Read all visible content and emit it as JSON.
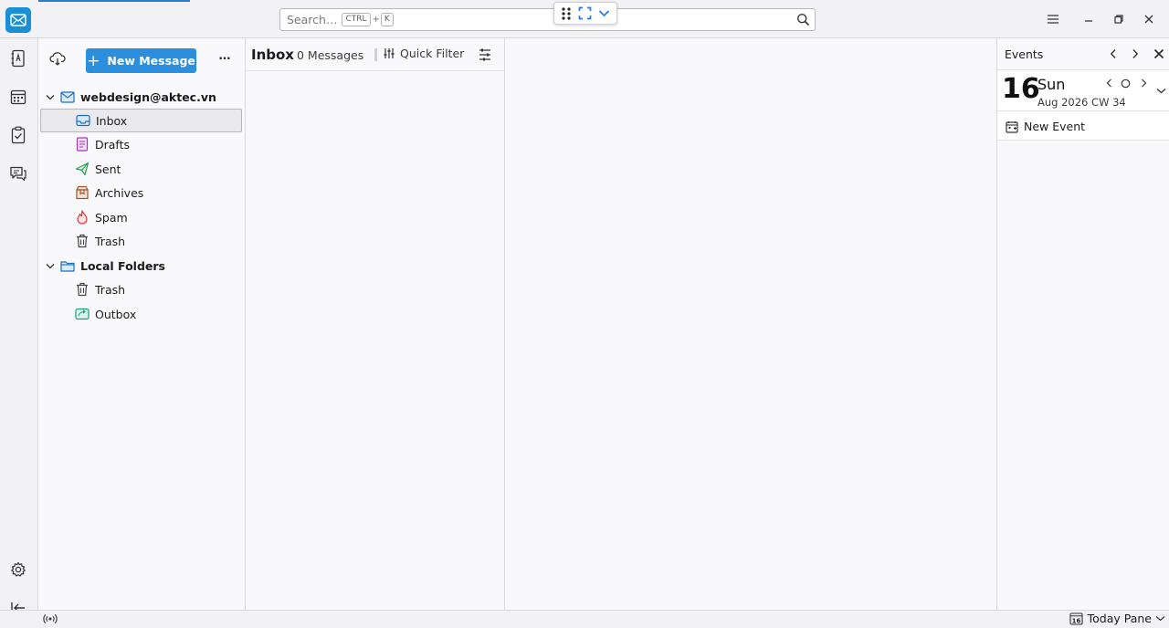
{
  "colors": {
    "accent": "#2b8fde",
    "app_icon": "#1a8fd6"
  },
  "search": {
    "placeholder": "Search…",
    "shortcut_mod": "CTRL",
    "shortcut_plus": "+",
    "shortcut_key": "K"
  },
  "window_controls": [
    "menu-icon",
    "minimize-icon",
    "restore-icon",
    "close-icon"
  ],
  "spaces": [
    {
      "name": "mail-icon"
    },
    {
      "name": "address-book-icon"
    },
    {
      "name": "calendar-icon"
    },
    {
      "name": "tasks-icon"
    },
    {
      "name": "chat-icon"
    },
    {
      "name": "settings-icon"
    },
    {
      "name": "collapse-spaces-icon"
    }
  ],
  "folder_pane": {
    "new_message_plus": "+",
    "new_message_label": "New Message",
    "more_label": "…",
    "accounts": [
      {
        "name": "webdesign@aktec.vn",
        "folders": [
          {
            "label": "Inbox",
            "icon": "inbox-icon",
            "selected": true
          },
          {
            "label": "Drafts",
            "icon": "drafts-icon"
          },
          {
            "label": "Sent",
            "icon": "sent-icon"
          },
          {
            "label": "Archives",
            "icon": "archives-icon"
          },
          {
            "label": "Spam",
            "icon": "spam-icon"
          },
          {
            "label": "Trash",
            "icon": "trash-icon"
          }
        ]
      },
      {
        "name": "Local Folders",
        "folders": [
          {
            "label": "Trash",
            "icon": "trash-icon"
          },
          {
            "label": "Outbox",
            "icon": "outbox-icon"
          }
        ]
      }
    ]
  },
  "thread_pane": {
    "folder_name": "Inbox",
    "message_count": "0 Messages",
    "quick_filter_label": "Quick Filter"
  },
  "today_pane": {
    "title": "Events",
    "day_number": "16",
    "day_name": "Sun",
    "date_meta": "Aug 2026 CW 34",
    "new_event_label": "New Event"
  },
  "status_bar": {
    "today_pane_label": "Today Pane",
    "today_icon_day": "16"
  }
}
